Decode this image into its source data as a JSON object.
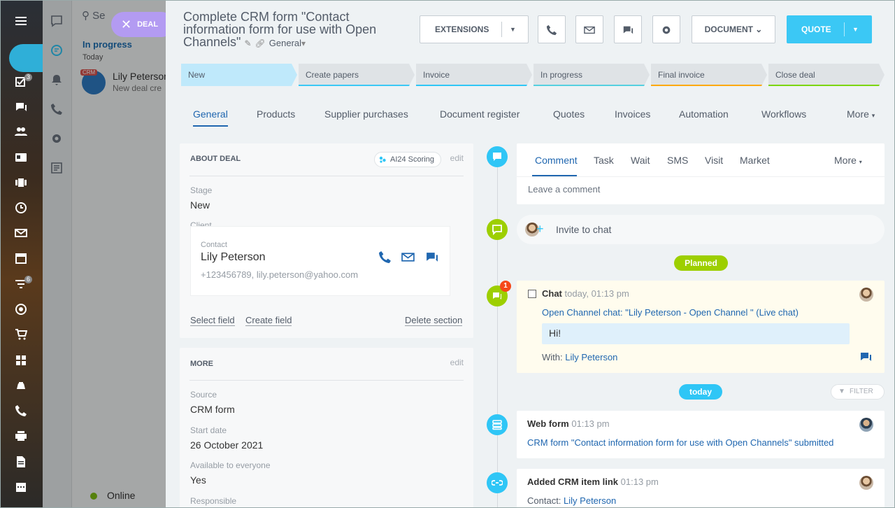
{
  "messenger": {
    "search_placeholder": "Se",
    "deal_pill": "DEAL",
    "section": "In progress",
    "day": "Today",
    "chat_tag": "CRM",
    "chat_name": "Lily Peterson",
    "chat_preview": "New deal cre",
    "status": "Online",
    "badge_tasks": "3",
    "badge_filter": "6"
  },
  "header": {
    "title": "Complete CRM form \"Contact information form for use with Open Channels\"",
    "category": "General",
    "extensions": "EXTENSIONS",
    "document": "DOCUMENT",
    "quote": "QUOTE"
  },
  "stages": [
    {
      "label": "New",
      "color": "#bfe9fb"
    },
    {
      "label": "Create papers",
      "color": "#3bc8f5"
    },
    {
      "label": "Invoice",
      "color": "#2fc6f6"
    },
    {
      "label": "In progress",
      "color": "#55d0e0"
    },
    {
      "label": "Final invoice",
      "color": "#ffa900"
    },
    {
      "label": "Close deal",
      "color": "#7bd500"
    }
  ],
  "tabs": [
    "General",
    "Products",
    "Supplier purchases",
    "Document register",
    "Quotes",
    "Invoices",
    "Automation",
    "Workflows",
    "More"
  ],
  "about": {
    "title": "ABOUT DEAL",
    "scoring": "AI24 Scoring",
    "edit": "edit",
    "stage_label": "Stage",
    "stage_value": "New",
    "client_label": "Client",
    "contact_label": "Contact",
    "contact_name": "Lily Peterson",
    "contact_info": "+123456789, lily.peterson@yahoo.com",
    "select_field": "Select field",
    "create_field": "Create field",
    "delete_section": "Delete section"
  },
  "more": {
    "title": "MORE",
    "edit": "edit",
    "source_label": "Source",
    "source_value": "CRM form",
    "start_label": "Start date",
    "start_value": "26 October 2021",
    "avail_label": "Available to everyone",
    "avail_value": "Yes",
    "resp_label": "Responsible"
  },
  "timeline": {
    "tabs": [
      "Comment",
      "Task",
      "Wait",
      "SMS",
      "Visit",
      "Market"
    ],
    "more": "More",
    "comment_placeholder": "Leave a comment",
    "invite": "Invite to chat",
    "planned": "Planned",
    "chat_badge": "1",
    "chat_title": "Chat",
    "chat_time": "today, 01:13 pm",
    "chat_link": "Open Channel chat: \"Lily Peterson - Open Channel \" (Live chat)",
    "chat_message": "Hi!",
    "with_label": "With:",
    "with_name": "Lily Peterson",
    "today": "today",
    "filter": "FILTER",
    "webform_title": "Web form",
    "webform_time": "01:13 pm",
    "webform_text": "CRM form \"Contact information form for use with Open Channels\" submitted",
    "link_title": "Added CRM item link",
    "link_time": "01:13 pm",
    "link_label": "Contact:",
    "link_name": "Lily Peterson"
  }
}
